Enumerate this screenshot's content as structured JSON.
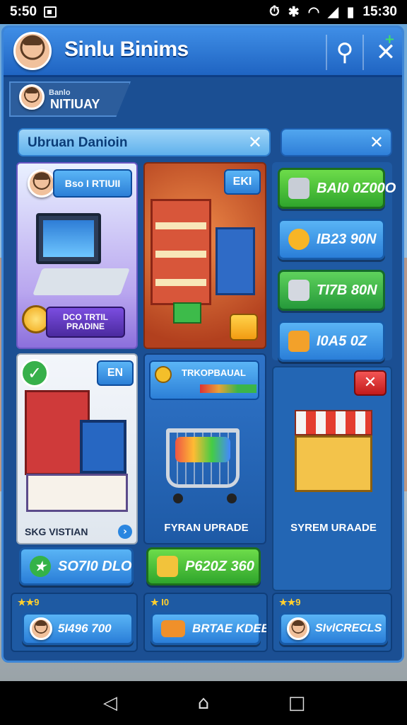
{
  "status_bar": {
    "time_left": "5:50",
    "time_right": "15:30"
  },
  "header": {
    "title": "Sinlu Binims"
  },
  "user": {
    "small_label": "Banlo",
    "name": "NITIUAY"
  },
  "search": {
    "value": "Ubruan Danioin"
  },
  "cards": {
    "computer": {
      "badge": "Bso I RTIUII",
      "promo": "DCO TRTIL PRADINE"
    },
    "shop": {
      "badge": "EKI"
    },
    "display": {
      "badge": "EN",
      "footer": "SKG VISTIAN"
    },
    "cart": {
      "header": "TRKOPBAUAL",
      "footer": "FYRAN UPRADE"
    },
    "stall": {
      "footer": "SYREM URAADE"
    }
  },
  "resources": [
    {
      "value": "BAI0 0Z00O",
      "icon": "crate-icon",
      "color": "green"
    },
    {
      "value": "IB23 90N",
      "icon": "coin-stack-icon",
      "color": "blue"
    },
    {
      "value": "TI7B 80N",
      "icon": "box-icon",
      "color": "green2"
    },
    {
      "value": "I0A5 0Z",
      "icon": "package-icon",
      "color": "blue"
    }
  ],
  "action_buttons": [
    {
      "label": "SO7I0 DLO",
      "icon": "star-icon"
    },
    {
      "label": "P620Z 360",
      "icon": "cash-icon"
    }
  ],
  "bottom_slots": [
    {
      "stars": "★★9",
      "label": "5I496 700"
    },
    {
      "stars": "★ I0",
      "label": "BRTAE KDEB"
    },
    {
      "stars": "★★9",
      "label": "SIvlCRECLS"
    }
  ],
  "nav": {
    "back": "◁",
    "home": "⌂",
    "recent": "□"
  }
}
